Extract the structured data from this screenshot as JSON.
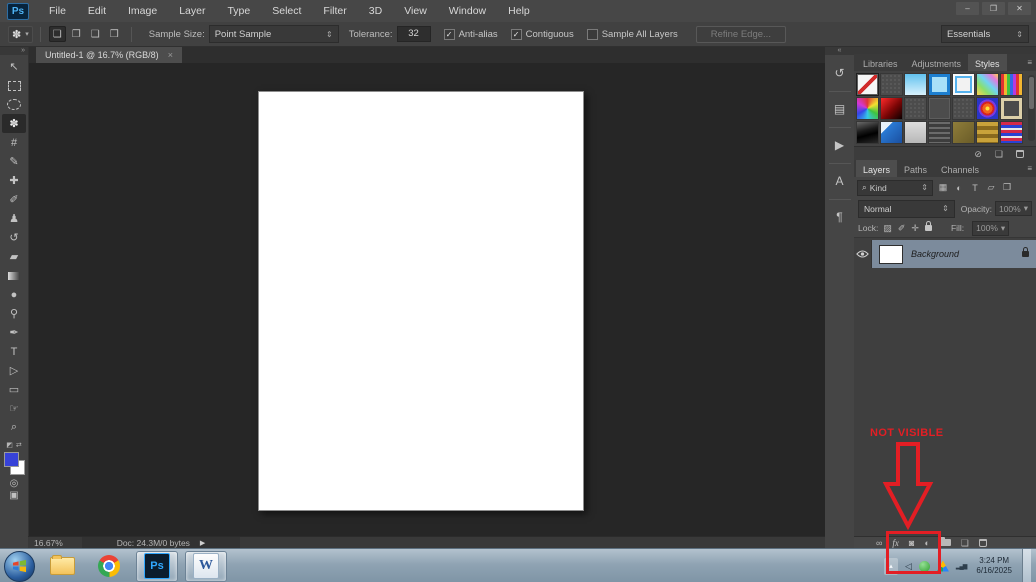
{
  "icons": {
    "dropdown": "⇕",
    "dropdown_small": "▾",
    "check": "✓",
    "caret": "▾"
  },
  "window": {
    "minimize_icon": "–",
    "restore_icon": "❐",
    "close_icon": "✕"
  },
  "menu_bar": {
    "logo_text": "Ps",
    "items": [
      "File",
      "Edit",
      "Image",
      "Layer",
      "Type",
      "Select",
      "Filter",
      "3D",
      "View",
      "Window",
      "Help"
    ]
  },
  "options_bar": {
    "tool_preset_icon": "✽",
    "selection_modes": [
      {
        "name": "new-selection-icon",
        "glyph": "❏",
        "pressed": true
      },
      {
        "name": "add-to-selection-icon",
        "glyph": "❐",
        "pressed": false
      },
      {
        "name": "subtract-from-selection-icon",
        "glyph": "❑",
        "pressed": false
      },
      {
        "name": "intersect-selection-icon",
        "glyph": "❒",
        "pressed": false
      }
    ],
    "sample_size_label": "Sample Size:",
    "sample_size_value": "Point Sample",
    "tolerance_label": "Tolerance:",
    "tolerance_value": "32",
    "checkboxes": [
      {
        "name": "anti-alias-checkbox",
        "label": "Anti-alias",
        "checked": true
      },
      {
        "name": "contiguous-checkbox",
        "label": "Contiguous",
        "checked": true
      },
      {
        "name": "sample-all-layers-checkbox",
        "label": "Sample All Layers",
        "checked": false
      }
    ],
    "refine_edge_label": "Refine Edge...",
    "workspace_value": "Essentials"
  },
  "document_tab": {
    "title": "Untitled-1 @ 16.7% (RGB/8)",
    "close_icon": "×"
  },
  "toolbar": {
    "collapse_icon": "»",
    "tools": [
      {
        "name": "move-tool",
        "glyph": "↖"
      },
      {
        "name": "marquee-tool",
        "shape": "dashed-rect"
      },
      {
        "name": "lasso-tool",
        "shape": "dashed-ellipse"
      },
      {
        "name": "magic-wand-tool",
        "glyph": "✽",
        "selected": true
      },
      {
        "name": "crop-tool",
        "glyph": "#"
      },
      {
        "name": "eyedropper-tool",
        "glyph": "✎"
      },
      {
        "name": "healing-brush-tool",
        "glyph": "✚"
      },
      {
        "name": "brush-tool",
        "glyph": "✐"
      },
      {
        "name": "clone-stamp-tool",
        "glyph": "♟"
      },
      {
        "name": "history-brush-tool",
        "glyph": "↺"
      },
      {
        "name": "eraser-tool",
        "glyph": "▰"
      },
      {
        "name": "gradient-tool",
        "shape": "gradient-box"
      },
      {
        "name": "blur-tool",
        "glyph": "●"
      },
      {
        "name": "dodge-tool",
        "glyph": "⚲"
      },
      {
        "name": "pen-tool",
        "glyph": "✒"
      },
      {
        "name": "type-tool",
        "glyph": "T"
      },
      {
        "name": "path-selection-tool",
        "glyph": "▷"
      },
      {
        "name": "rectangle-tool",
        "glyph": "▭"
      },
      {
        "name": "hand-tool",
        "glyph": "☞"
      },
      {
        "name": "zoom-tool",
        "glyph": "⌕"
      }
    ],
    "default_colors_icon": "◩",
    "swap_colors_icon": "⇄",
    "foreground_color": "#3742d8",
    "background_color": "#ffffff",
    "quick_mask_icon": "◎",
    "screen_mode_icon": "▣"
  },
  "dock_strip": {
    "collapse_icon": "«",
    "icons": [
      {
        "name": "history-panel-icon",
        "glyph": "↺"
      },
      {
        "name": "device-preview-panel-icon",
        "glyph": "▤"
      },
      {
        "name": "actions-panel-icon",
        "glyph": "▶"
      },
      {
        "name": "character-panel-icon",
        "glyph": "A"
      },
      {
        "name": "paragraph-panel-icon",
        "glyph": "¶"
      }
    ]
  },
  "panels": {
    "panel_menu_icon": "≡",
    "top_tabs": [
      {
        "label": "Libraries",
        "active": false
      },
      {
        "label": "Adjustments",
        "active": false
      },
      {
        "label": "Styles",
        "active": true
      }
    ],
    "styles": {
      "swatches": [
        {
          "name": "none",
          "bg": "linear-gradient(135deg, rgba(0,0,0,0) 44%, #d02a2a 44%, #d02a2a 56%, rgba(0,0,0,0) 56%), #f5f5f5",
          "selected": true
        },
        {
          "name": "dotted-gray-1",
          "bg": "radial-gradient(#7a7a7a 18%, rgba(0,0,0,0) 21%) 0 0 / 4px 4px, #4c4c4c"
        },
        {
          "name": "sky-blue-gradient",
          "bg": "linear-gradient(#62c2ef, #d8f1fc)"
        },
        {
          "name": "blue-frame",
          "bg": "#a8e0f8",
          "shadow": "inset 0 0 0 3px #1d7fd0"
        },
        {
          "name": "white-blue-outline",
          "bg": "#f2f2f2",
          "shadow": "inset 0 0 0 2px #fafafa, inset 0 0 0 4px #55b2ee"
        },
        {
          "name": "pastel-rainbow",
          "bg": "linear-gradient(45deg, #ffd24d, #8be06c 30%, #6fd4f2 55%, #e07ae0 80%, #ffd24d)"
        },
        {
          "name": "rainbow-stripes",
          "bg": "repeating-linear-gradient(90deg, #e23232 0 3px, #f2b630 3px 6px, #3fc43f 6px 9px, #3468e8 9px 12px, #b53ae0 12px 15px)"
        },
        {
          "name": "color-checker",
          "bg": "conic-gradient(#e23232, #f2e130, #3fc43f, #35c8e8, #3446e8, #d437d4, #e23232)"
        },
        {
          "name": "red-black-gradient",
          "bg": "linear-gradient(135deg, #ff2a2a, #7a0505 55%, #0a0000)"
        },
        {
          "name": "dotted-gray-2",
          "bg": "radial-gradient(#7a7a7a 18%, rgba(0,0,0,0) 21%) 0 0 / 4px 4px, #4c4c4c"
        },
        {
          "name": "faint-square",
          "bg": "#4c4c4c",
          "shadow": "inset 0 0 0 1px #5d5d5d"
        },
        {
          "name": "dotted-gray-3",
          "bg": "radial-gradient(#7a7a7a 18%, rgba(0,0,0,0) 21%) 0 0 / 4px 4px, #4c4c4c"
        },
        {
          "name": "purple-bullseye",
          "bg": "radial-gradient(circle, #ffe23a 0 2px, #f2641d 2px 5px, #d42222 5px 7px, #7a3ae0 7px 9px, #2a35c8 9px)"
        },
        {
          "name": "tan-frame",
          "bg": "#4a4a4a",
          "shadow": "inset 0 0 0 3px #dccfa8"
        },
        {
          "name": "black-gloss",
          "bg": "linear-gradient(165deg, #6a6a6a, #1a1a1a 40%, #000 60%, #2a2a2a)"
        },
        {
          "name": "blue-glass",
          "bg": "linear-gradient(135deg, #e8f2fa 0 28%, #2a7ad4 28%, #1a4fa0)"
        },
        {
          "name": "light-gray",
          "bg": "linear-gradient(#dedede, #b8b8b8)"
        },
        {
          "name": "thin-stripes",
          "bg": "repeating-linear-gradient(#6a6a6a 0 2px, #3d3d3d 2px 5px)"
        },
        {
          "name": "olive-texture",
          "bg": "linear-gradient(135deg, #8f7d3a, #6a5c28)"
        },
        {
          "name": "gold-bands",
          "bg": "repeating-linear-gradient(#c9a23a 0 4px, #8a6a1d 4px 8px)"
        },
        {
          "name": "red-blue-stripes",
          "bg": "repeating-linear-gradient(#d42a4a 0 3px, #2a42d4 3px 6px, #e8e8e8 6px 8px)"
        }
      ],
      "footer": [
        {
          "name": "clear-style-icon",
          "glyph": "⊘"
        },
        {
          "name": "new-style-icon",
          "glyph": "❏"
        },
        {
          "name": "delete-style-icon",
          "shape": "trash"
        }
      ]
    },
    "layers_tabs": [
      {
        "label": "Layers",
        "active": true
      },
      {
        "label": "Paths",
        "active": false
      },
      {
        "label": "Channels",
        "active": false
      }
    ],
    "filter_row": {
      "search_icon": "⌕",
      "kind_value": "Kind",
      "icons": [
        {
          "name": "filter-pixel-layers-icon",
          "glyph": "▦"
        },
        {
          "name": "filter-adjustment-layers-icon",
          "glyph": "◐"
        },
        {
          "name": "filter-type-layers-icon",
          "glyph": "T"
        },
        {
          "name": "filter-shape-layers-icon",
          "glyph": "▱"
        },
        {
          "name": "filter-smart-objects-icon",
          "glyph": "❒"
        }
      ]
    },
    "blend_row": {
      "mode_value": "Normal",
      "opacity_label": "Opacity:",
      "opacity_value": "100%"
    },
    "lock_row": {
      "lock_label": "Lock:",
      "icons": [
        {
          "name": "lock-transparency-icon",
          "glyph": "▨"
        },
        {
          "name": "lock-paint-icon",
          "glyph": "✐"
        },
        {
          "name": "lock-position-icon",
          "glyph": "✛"
        },
        {
          "name": "lock-all-icon",
          "shape": "lock"
        }
      ],
      "fill_label": "Fill:",
      "fill_value": "100%"
    },
    "layer": {
      "name": "Background"
    },
    "bottom_icons": [
      {
        "name": "link-layers-icon",
        "glyph": "∞"
      },
      {
        "name": "layer-effects-icon",
        "glyph": "fx",
        "fx": true
      },
      {
        "name": "layer-mask-icon",
        "glyph": "◙"
      },
      {
        "name": "adjustment-layer-icon",
        "glyph": "◐"
      },
      {
        "name": "new-group-icon",
        "shape": "folder"
      },
      {
        "name": "new-layer-icon",
        "glyph": "❏"
      },
      {
        "name": "delete-layer-icon",
        "shape": "trash"
      }
    ]
  },
  "status_bar": {
    "zoom_value": "16.67%",
    "doc_info": "Doc: 24.3M/0 bytes",
    "expand_icon": "▶"
  },
  "annotation": {
    "label": "NOT VISIBLE",
    "color": "#e31e24"
  },
  "taskbar": {
    "photoshop_label": "Ps",
    "word_label": "W",
    "tray_arrow_icon": "▴",
    "volume_icon": "◁",
    "network_icon": "▂▄▆",
    "clock_time": "3:24 PM",
    "clock_date": "6/16/2025"
  }
}
